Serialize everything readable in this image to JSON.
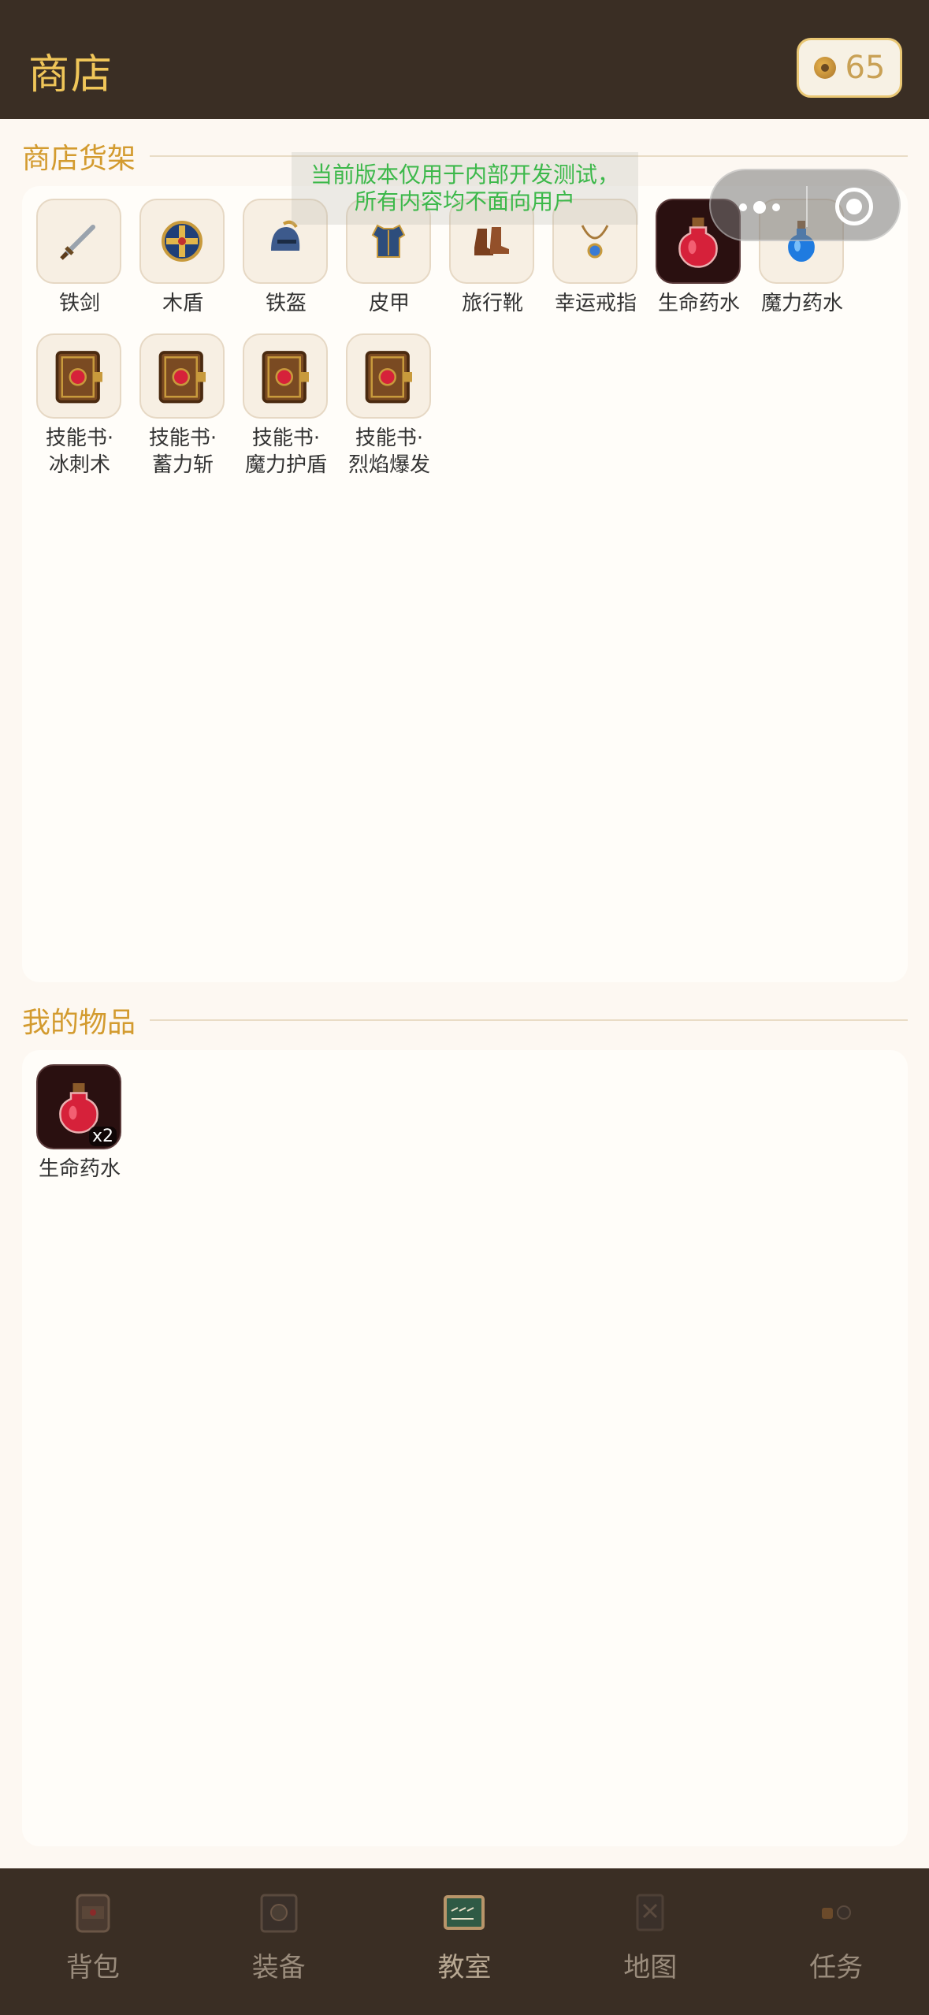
{
  "header": {
    "title": "商店",
    "coins": "65"
  },
  "notice": {
    "line1": "当前版本仅用于内部开发测试，",
    "line2": "所有内容均不面向用户"
  },
  "shop": {
    "section_title": "商店货架",
    "items": [
      {
        "name": "铁剑",
        "icon": "sword-icon"
      },
      {
        "name": "木盾",
        "icon": "shield-icon"
      },
      {
        "name": "铁盔",
        "icon": "helmet-icon"
      },
      {
        "name": "皮甲",
        "icon": "armor-icon"
      },
      {
        "name": "旅行靴",
        "icon": "boots-icon"
      },
      {
        "name": "幸运戒指",
        "icon": "ring-icon"
      },
      {
        "name": "生命药水",
        "icon": "health-potion-icon"
      },
      {
        "name": "魔力药水",
        "icon": "mana-potion-icon"
      },
      {
        "name": "技能书·冰刺术",
        "line1": "技能书·",
        "line2": "冰刺术",
        "icon": "skill-book-icon"
      },
      {
        "name": "技能书·蓄力斩",
        "line1": "技能书·",
        "line2": "蓄力斩",
        "icon": "skill-book-icon"
      },
      {
        "name": "技能书·魔力护盾",
        "line1": "技能书·",
        "line2": "魔力护盾",
        "icon": "skill-book-icon"
      },
      {
        "name": "技能书·烈焰爆发",
        "line1": "技能书·",
        "line2": "烈焰爆发",
        "icon": "skill-book-icon"
      }
    ]
  },
  "inventory": {
    "section_title": "我的物品",
    "items": [
      {
        "name": "生命药水",
        "count": "x2",
        "icon": "health-potion-icon"
      }
    ]
  },
  "nav": {
    "items": [
      {
        "label": "背包",
        "icon": "backpack-icon"
      },
      {
        "label": "装备",
        "icon": "equipment-icon"
      },
      {
        "label": "教室",
        "icon": "classroom-icon"
      },
      {
        "label": "地图",
        "icon": "map-icon"
      },
      {
        "label": "任务",
        "icon": "quest-icon"
      }
    ]
  },
  "colors": {
    "header_bg": "#3a2e24",
    "title": "#f0c659",
    "section": "#d39b2f",
    "notice": "#3cb84a"
  }
}
